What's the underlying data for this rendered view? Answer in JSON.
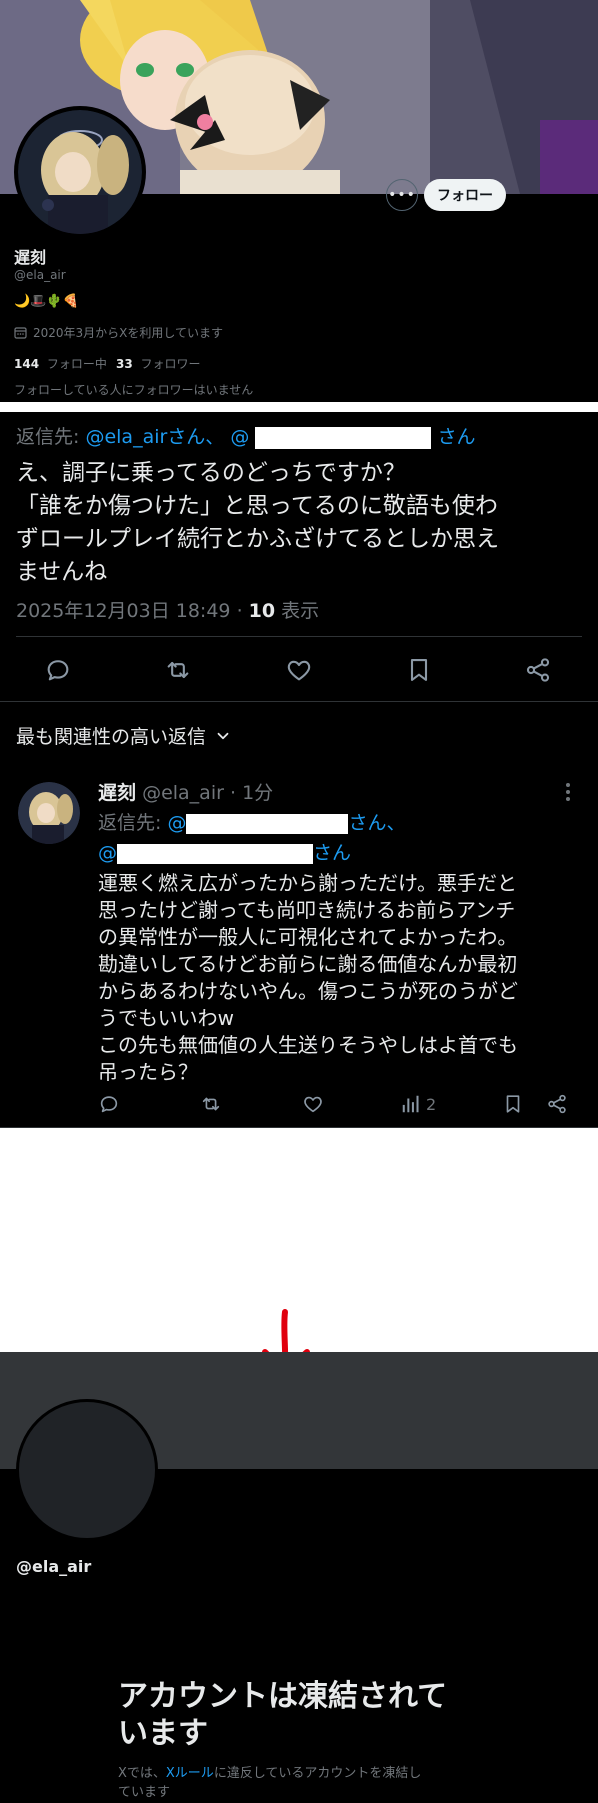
{
  "profile": {
    "display_name": "遅刻",
    "handle": "@ela_air",
    "bio_emoji": "🌙🎩🌵🍕",
    "joined": "2020年3月からXを利用しています",
    "following_count": "144",
    "following_label": "フォロー中",
    "followers_count": "33",
    "followers_label": "フォロワー",
    "mutual_note": "フォローしている人にフォロワーはいません",
    "follow_button": "フォロー",
    "more_icon": "ellipsis-icon",
    "calendar_icon": "calendar-icon"
  },
  "tweet": {
    "reply_prefix": "返信先:",
    "reply_to_1": "@ela_airさん、",
    "reply_to_2": "@",
    "reply_suffix": "さん",
    "body_lines": [
      "え、調子に乗ってるのどっちですか？",
      "「誰をか傷つけた」と思ってるのに敬語も使わ",
      "ずロールプレイ続行とかふざけてるとしか思え",
      "ませんね"
    ],
    "timestamp": "2025年12月03日 18:49",
    "separator": "·",
    "views_count": "10",
    "views_label": "表示"
  },
  "replies": {
    "sort_label": "最も関連性の高い返信",
    "sort_icon": "chevron-down-icon"
  },
  "reply": {
    "name": "遅刻",
    "handle": "@ela_air",
    "dot": "·",
    "time": "1分",
    "reply_prefix": "返信先:",
    "reply_to_1": "@",
    "reply_mid": "さん、",
    "reply_to_2": "@",
    "reply_suffix": "さん",
    "body_lines": [
      "運悪く燃え広がったから謝っただけ。悪手だと",
      "思ったけど謝っても尚叩き続けるお前らアンチ",
      "の異常性が一般人に可視化されてよかったわ。",
      "勘違いしてるけどお前らに謝る価値なんか最初",
      "からあるわけないやん。傷つこうが死のうがど",
      "うでもいいわw",
      "この先も無価値の人生送りそうやしはよ首でも",
      "吊ったら？"
    ],
    "views_count": "2"
  },
  "suspended": {
    "handle": "@ela_air",
    "title_line1": "アカウントは凍結されて",
    "title_line2": "います",
    "desc_prefix": "Xでは、",
    "desc_link": "Xルール",
    "desc_suffix": "に違反しているアカウントを凍結し",
    "desc_line2": "ています"
  },
  "colors": {
    "background": "#000000",
    "text": "#e7e9ea",
    "muted": "#71767b",
    "link": "#1d9bf0",
    "divider": "#2f3336",
    "annotation_arrow": "#e0000e"
  }
}
